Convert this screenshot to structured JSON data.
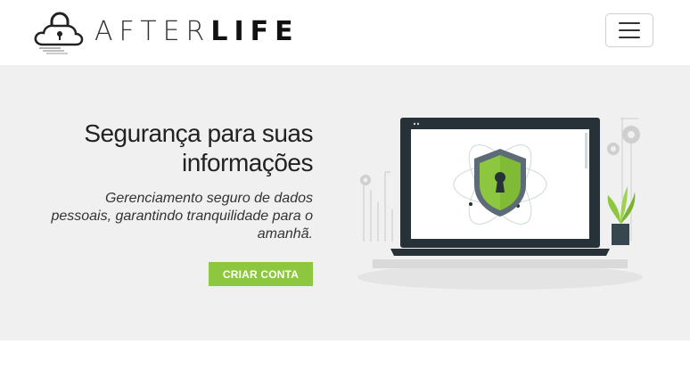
{
  "header": {
    "logo_text_light": "AFTER",
    "logo_text_bold": "LIFE",
    "menu_icon": "hamburger-icon"
  },
  "hero": {
    "title": "Segurança para suas informações",
    "subtitle": "Gerenciamento seguro de dados pessoais, garantindo tranquilidade para o amanhã.",
    "cta_label": "CRIAR CONTA"
  },
  "colors": {
    "accent": "#8dc63f",
    "hero_bg": "#f0f0f0",
    "laptop": "#263238",
    "shield_outer": "#5d6a78",
    "shield_inner": "#8dc63f"
  }
}
